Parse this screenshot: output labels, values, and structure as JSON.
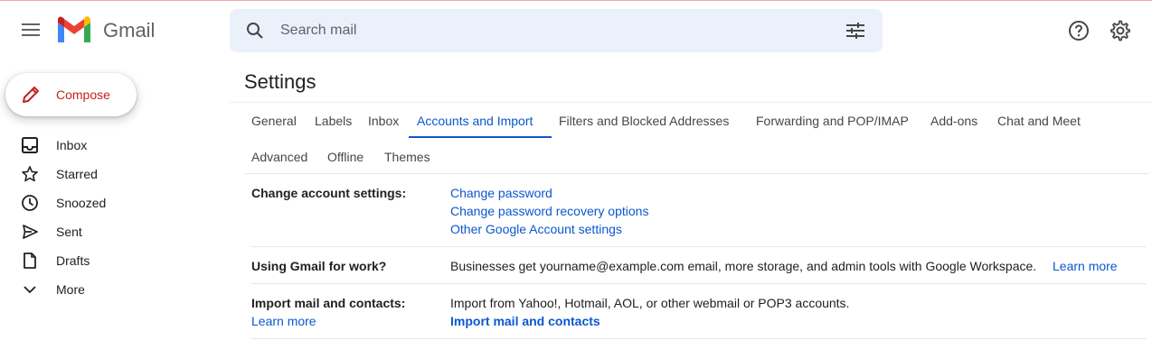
{
  "header": {
    "brand": "Gmail",
    "search_placeholder": "Search mail"
  },
  "sidebar": {
    "compose_label": "Compose",
    "items": [
      {
        "label": "Inbox",
        "icon": "inbox-icon"
      },
      {
        "label": "Starred",
        "icon": "star-icon"
      },
      {
        "label": "Snoozed",
        "icon": "clock-icon"
      },
      {
        "label": "Sent",
        "icon": "send-icon"
      },
      {
        "label": "Drafts",
        "icon": "draft-icon"
      },
      {
        "label": "More",
        "icon": "chevron-down-icon"
      }
    ]
  },
  "settings": {
    "title": "Settings",
    "tabs": [
      {
        "label": "General"
      },
      {
        "label": "Labels"
      },
      {
        "label": "Inbox"
      },
      {
        "label": "Accounts and Import",
        "active": true
      },
      {
        "label": "Filters and Blocked Addresses"
      },
      {
        "label": "Forwarding and POP/IMAP"
      },
      {
        "label": "Add-ons"
      },
      {
        "label": "Chat and Meet"
      },
      {
        "label": "Advanced"
      },
      {
        "label": "Offline"
      },
      {
        "label": "Themes"
      }
    ],
    "rows": {
      "change_account": {
        "label": "Change account settings:",
        "links": [
          "Change password",
          "Change password recovery options",
          "Other Google Account settings"
        ]
      },
      "gmail_work": {
        "label": "Using Gmail for work?",
        "text": "Businesses get yourname@example.com email, more storage, and admin tools with Google Workspace.",
        "link": "Learn more"
      },
      "import": {
        "label": "Import mail and contacts:",
        "learn_more": "Learn more",
        "text": "Import from Yahoo!, Hotmail, AOL, or other webmail or POP3 accounts.",
        "action": "Import mail and contacts"
      }
    }
  },
  "colors": {
    "accent": "#0b57d0",
    "compose_text": "#c5221f",
    "search_bg": "#eaf1fb"
  }
}
